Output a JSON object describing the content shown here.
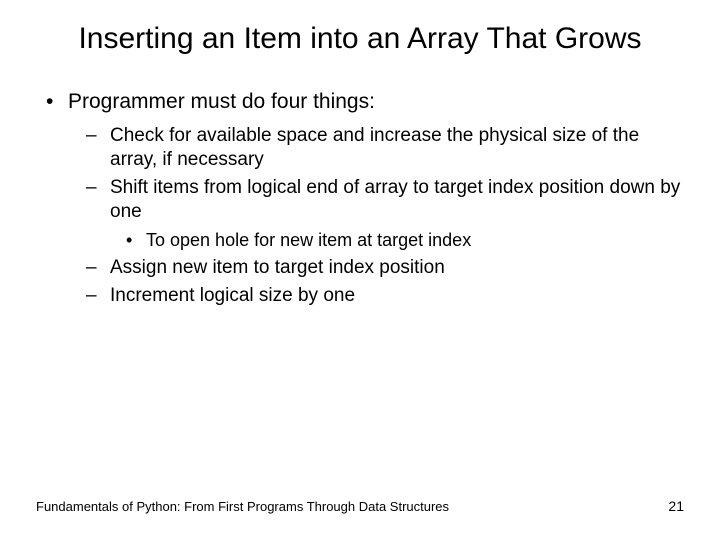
{
  "title": "Inserting an Item into an Array That Grows",
  "bullets": {
    "level1": [
      {
        "text": "Programmer must do four things:",
        "level2": [
          {
            "text": "Check for available space and increase the physical size of the array, if necessary"
          },
          {
            "text": "Shift items from logical end of array to target index position down by one",
            "level3": [
              {
                "text": "To open hole for new item at target index"
              }
            ]
          },
          {
            "text": "Assign new item to target index position"
          },
          {
            "text": "Increment logical size by one"
          }
        ]
      }
    ]
  },
  "footer": {
    "source": "Fundamentals of Python: From First Programs Through Data Structures",
    "page": "21"
  }
}
